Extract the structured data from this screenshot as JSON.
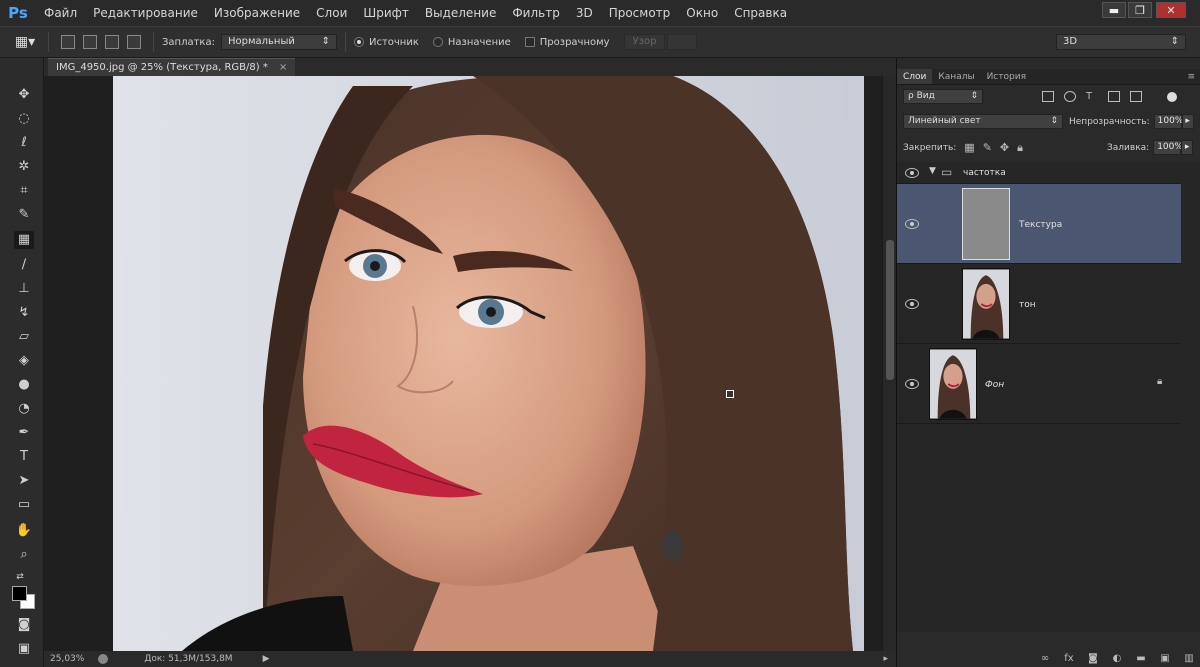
{
  "app": {
    "logo": "Ps"
  },
  "menu": [
    "Файл",
    "Редактирование",
    "Изображение",
    "Слои",
    "Шрифт",
    "Выделение",
    "Фильтр",
    "3D",
    "Просмотр",
    "Окно",
    "Справка"
  ],
  "window_controls": {
    "minimize": "▬",
    "restore": "❐",
    "close": "✕"
  },
  "options": {
    "patch_label": "Заплатка:",
    "patch_mode": "Нормальный",
    "source_label": "Источник",
    "dest_label": "Назначение",
    "transparent_label": "Прозрачному",
    "pattern_label": "Узор",
    "workspace": "3D"
  },
  "document": {
    "tab_title": "IMG_4950.jpg @ 25% (Текстура, RGB/8) *",
    "close": "×"
  },
  "status": {
    "zoom": "25,03%",
    "doc_info": "Док: 51,3M/153,8M"
  },
  "panel": {
    "tabs": [
      "Слои",
      "Каналы",
      "История"
    ],
    "filter_label": "ρ Вид",
    "blend_mode": "Линейный свет",
    "opacity_label": "Непрозрачность:",
    "opacity_value": "100%",
    "lock_label": "Закрепить:",
    "fill_label": "Заливка:",
    "fill_value": "100%",
    "layers": [
      {
        "name": "частотка",
        "type": "group"
      },
      {
        "name": "Текстура",
        "type": "layer",
        "selected": true
      },
      {
        "name": "тон",
        "type": "layer"
      },
      {
        "name": "Фон",
        "type": "background",
        "locked": true
      }
    ]
  },
  "footer_icons": [
    "link-icon",
    "fx-icon",
    "mask-icon",
    "adjustment-icon",
    "folder-icon",
    "new-layer-icon",
    "trash-icon"
  ],
  "colors": {
    "selected_layer": "#4b5670",
    "ps_blue": "#4aa8ff"
  }
}
